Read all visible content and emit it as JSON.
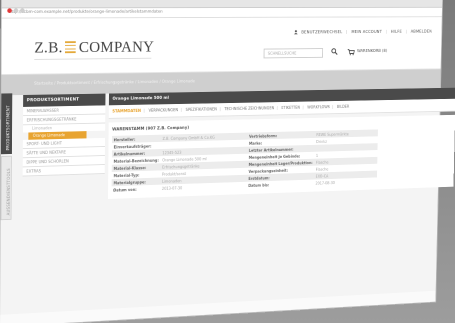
{
  "browser": {
    "url": "http://zcbm-com.example.net/produkte/orange-limonade/artikelstammdaten"
  },
  "header": {
    "logo_text_left": "Z.B.",
    "logo_text_right": "COMPANY",
    "nav": [
      "BENUTZERWECHSEL",
      "MEIN ACCOUNT",
      "HILFE",
      "ABMELDEN"
    ],
    "search_placeholder": "SCHNELLSUCHE",
    "cart_label": "WARENKORB (8)"
  },
  "breadcrumb": "Startseite / Produktsortiment / Erfrischungsgetränke / Limonaden / Orange Limonade",
  "vertical_tabs": [
    "PRODUKTSORTIMENT",
    "AUSSENDIENSTTOOLS"
  ],
  "sidebar": {
    "title": "PRODUKTSORTIMENT",
    "items": [
      "MINERALWASSER",
      "ERFRISCHUNGSGETRÄNKE"
    ],
    "subitems": [
      "Limonaden",
      "Orange Limonade"
    ],
    "more_items": [
      "SPORT- UND LIGHT",
      "SÄFTE UND NEKTARE",
      "DIPPE UND SCHORLEN",
      "EXTRAS"
    ]
  },
  "main": {
    "title": "Orange Limonade 500 ml",
    "tabs": [
      "STAMMDATEN",
      "VERPACKUNGEN",
      "SPEZIFIKATIONEN",
      "TECHNISCHE ZEICHNUNGEN",
      "ETIKETTEN",
      "WORKFLOWS",
      "BILDER"
    ],
    "panel_title": "WARENSTAMM (907 Z.B. Company)",
    "rows": [
      {
        "l1": "Hersteller:",
        "v1": "Z.B. Company GmbH & Co.KG",
        "l2": "Vertriebsform:",
        "v2": "REWE Supermärkte"
      },
      {
        "l1": "Einverkaufsträger:",
        "v1": "",
        "l2": "Marke:",
        "v2": "Drinkz"
      },
      {
        "l1": "Artikelnummer:",
        "v1": "12345-523",
        "l2": "Letzter Artikelnummer:",
        "v2": ""
      },
      {
        "l1": "Material-Bezeichnung:",
        "v1": "Orange Limonade 500 ml",
        "l2": "Mengeneinheit je Gebinde:",
        "v2": "1"
      },
      {
        "l1": "Material-Klasse:",
        "v1": "Erfrischungsgetränke",
        "l2": "Mengeneinheit Lager/Produktion:",
        "v2": "Flasche"
      },
      {
        "l1": "Material-Typ:",
        "v1": "Produkt/sonst",
        "l2": "Verpackungseinheit:",
        "v2": "Flasche"
      },
      {
        "l1": "Materialgruppe:",
        "v1": "Limonaden",
        "l2": "Erstdatum:",
        "v2": "EXO-CA"
      },
      {
        "l1": "Datum von:",
        "v1": "2013-07-30",
        "l2": "Datum bis:",
        "v2": "2017-08-30"
      }
    ]
  },
  "colors": {
    "accent": "#e8a431",
    "dark": "#4a4a4a",
    "browser_close": "#e23a3a"
  }
}
